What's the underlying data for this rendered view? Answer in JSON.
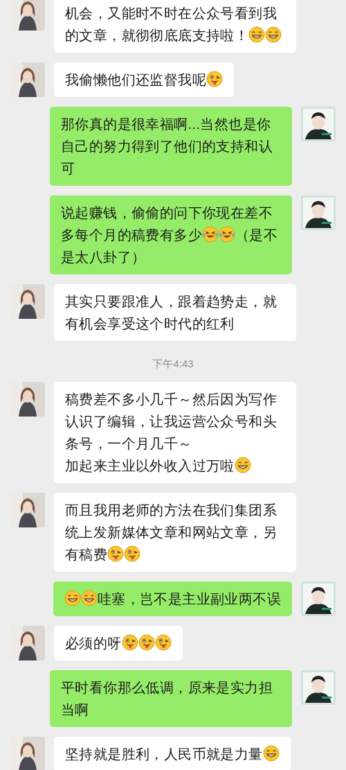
{
  "messages": [
    {
      "kind": "message",
      "outgoing": false,
      "parts": [
        {
          "kind": "text",
          "text": "机会，又能时不时在公众号看到我的文章，就彻彻底底支持啦！"
        },
        {
          "kind": "grin"
        },
        {
          "kind": "grin"
        }
      ]
    },
    {
      "kind": "message",
      "outgoing": false,
      "parts": [
        {
          "kind": "text",
          "text": "我偷懒他们还监督我呢"
        },
        {
          "kind": "tongue"
        }
      ]
    },
    {
      "kind": "message",
      "outgoing": true,
      "parts": [
        {
          "kind": "text",
          "text": "那你真的是很幸福啊...当然也是你自己的努力得到了他们的支持和认可"
        }
      ]
    },
    {
      "kind": "message",
      "outgoing": true,
      "parts": [
        {
          "kind": "text",
          "text": "说起赚钱，偷偷的问下你现在差不多每个月的稿费有多少"
        },
        {
          "kind": "laugh-cry"
        },
        {
          "kind": "laugh-cry"
        },
        {
          "kind": "text",
          "text": "（是不是太八卦了）"
        }
      ]
    },
    {
      "kind": "message",
      "outgoing": false,
      "parts": [
        {
          "kind": "text",
          "text": "其实只要跟准人，跟着趋势走，就有机会享受这个时代的红利"
        }
      ]
    },
    {
      "kind": "time",
      "text": "下午4:43"
    },
    {
      "kind": "message",
      "outgoing": false,
      "parts": [
        {
          "kind": "text",
          "text": "稿费差不多小几千～然后因为写作认识了编辑，让我运营公众号和头条号，一个月几千～"
        },
        {
          "kind": "line-break"
        },
        {
          "kind": "text",
          "text": "加起来主业以外收入过万啦"
        },
        {
          "kind": "grin"
        }
      ]
    },
    {
      "kind": "message",
      "outgoing": false,
      "parts": [
        {
          "kind": "text",
          "text": "而且我用老师的方法在我们集团系统上发新媒体文章和网站文章，另有稿费"
        },
        {
          "kind": "tongue"
        },
        {
          "kind": "tongue"
        }
      ]
    },
    {
      "kind": "message",
      "outgoing": true,
      "parts": [
        {
          "kind": "grin"
        },
        {
          "kind": "grin"
        },
        {
          "kind": "text",
          "text": "哇塞，岂不是主业副业两不误"
        }
      ]
    },
    {
      "kind": "message",
      "outgoing": false,
      "parts": [
        {
          "kind": "text",
          "text": "必须的呀"
        },
        {
          "kind": "tongue"
        },
        {
          "kind": "tongue"
        },
        {
          "kind": "tongue"
        }
      ]
    },
    {
      "kind": "message",
      "outgoing": true,
      "parts": [
        {
          "kind": "text",
          "text": "平时看你那么低调，原来是实力担当啊"
        }
      ]
    },
    {
      "kind": "message",
      "outgoing": false,
      "parts": [
        {
          "kind": "text",
          "text": "坚持就是胜利，人民币就是力量"
        },
        {
          "kind": "grin"
        }
      ]
    }
  ]
}
